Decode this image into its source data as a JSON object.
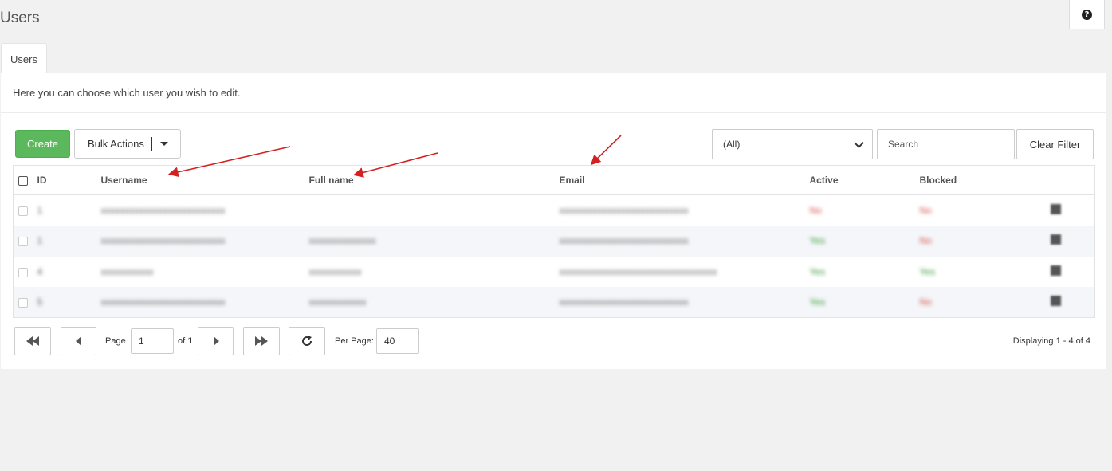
{
  "page": {
    "title": "Users",
    "help_glyph": "?"
  },
  "tabs": [
    {
      "label": "Users",
      "active": true
    }
  ],
  "intro_text": "Here you can choose which user you wish to edit.",
  "toolbar": {
    "create_label": "Create",
    "bulk_label": "Bulk Actions",
    "filter_selected": "(All)",
    "search_placeholder": "Search",
    "clear_label": "Clear Filter"
  },
  "table": {
    "columns": [
      "ID",
      "Username",
      "Full name",
      "Email",
      "Active",
      "Blocked"
    ],
    "rows": [
      {
        "id": "1",
        "username": "xxxxxxxxxxxxxxxxxxxxxxxxxx",
        "fullname": "",
        "email": "xxxxxxxxxxxxxxxxxxxxxxxxxxx",
        "active": "No",
        "blocked": "No"
      },
      {
        "id": "1",
        "username": "xxxxxxxxxxxxxxxxxxxxxxxxxx",
        "fullname": "xxxxxxxxxxxxxx",
        "email": "xxxxxxxxxxxxxxxxxxxxxxxxxxx",
        "active": "Yes",
        "blocked": "No"
      },
      {
        "id": "4",
        "username": "xxxxxxxxxxx",
        "fullname": "xxxxxxxxxxx",
        "email": "xxxxxxxxxxxxxxxxxxxxxxxxxxxxxxxxx",
        "active": "Yes",
        "blocked": "Yes"
      },
      {
        "id": "5",
        "username": "xxxxxxxxxxxxxxxxxxxxxxxxxx",
        "fullname": "xxxxxxxxxxxx",
        "email": "xxxxxxxxxxxxxxxxxxxxxxxxxxx",
        "active": "Yes",
        "blocked": "No"
      }
    ]
  },
  "pager": {
    "page_label": "Page",
    "page_value": "1",
    "of_label": "of 1",
    "per_page_label": "Per Page:",
    "per_page_value": "40",
    "displaying": "Displaying 1 - 4 of 4"
  },
  "colors": {
    "create": "#5cb85c",
    "annotation_arrow": "#d42020"
  }
}
